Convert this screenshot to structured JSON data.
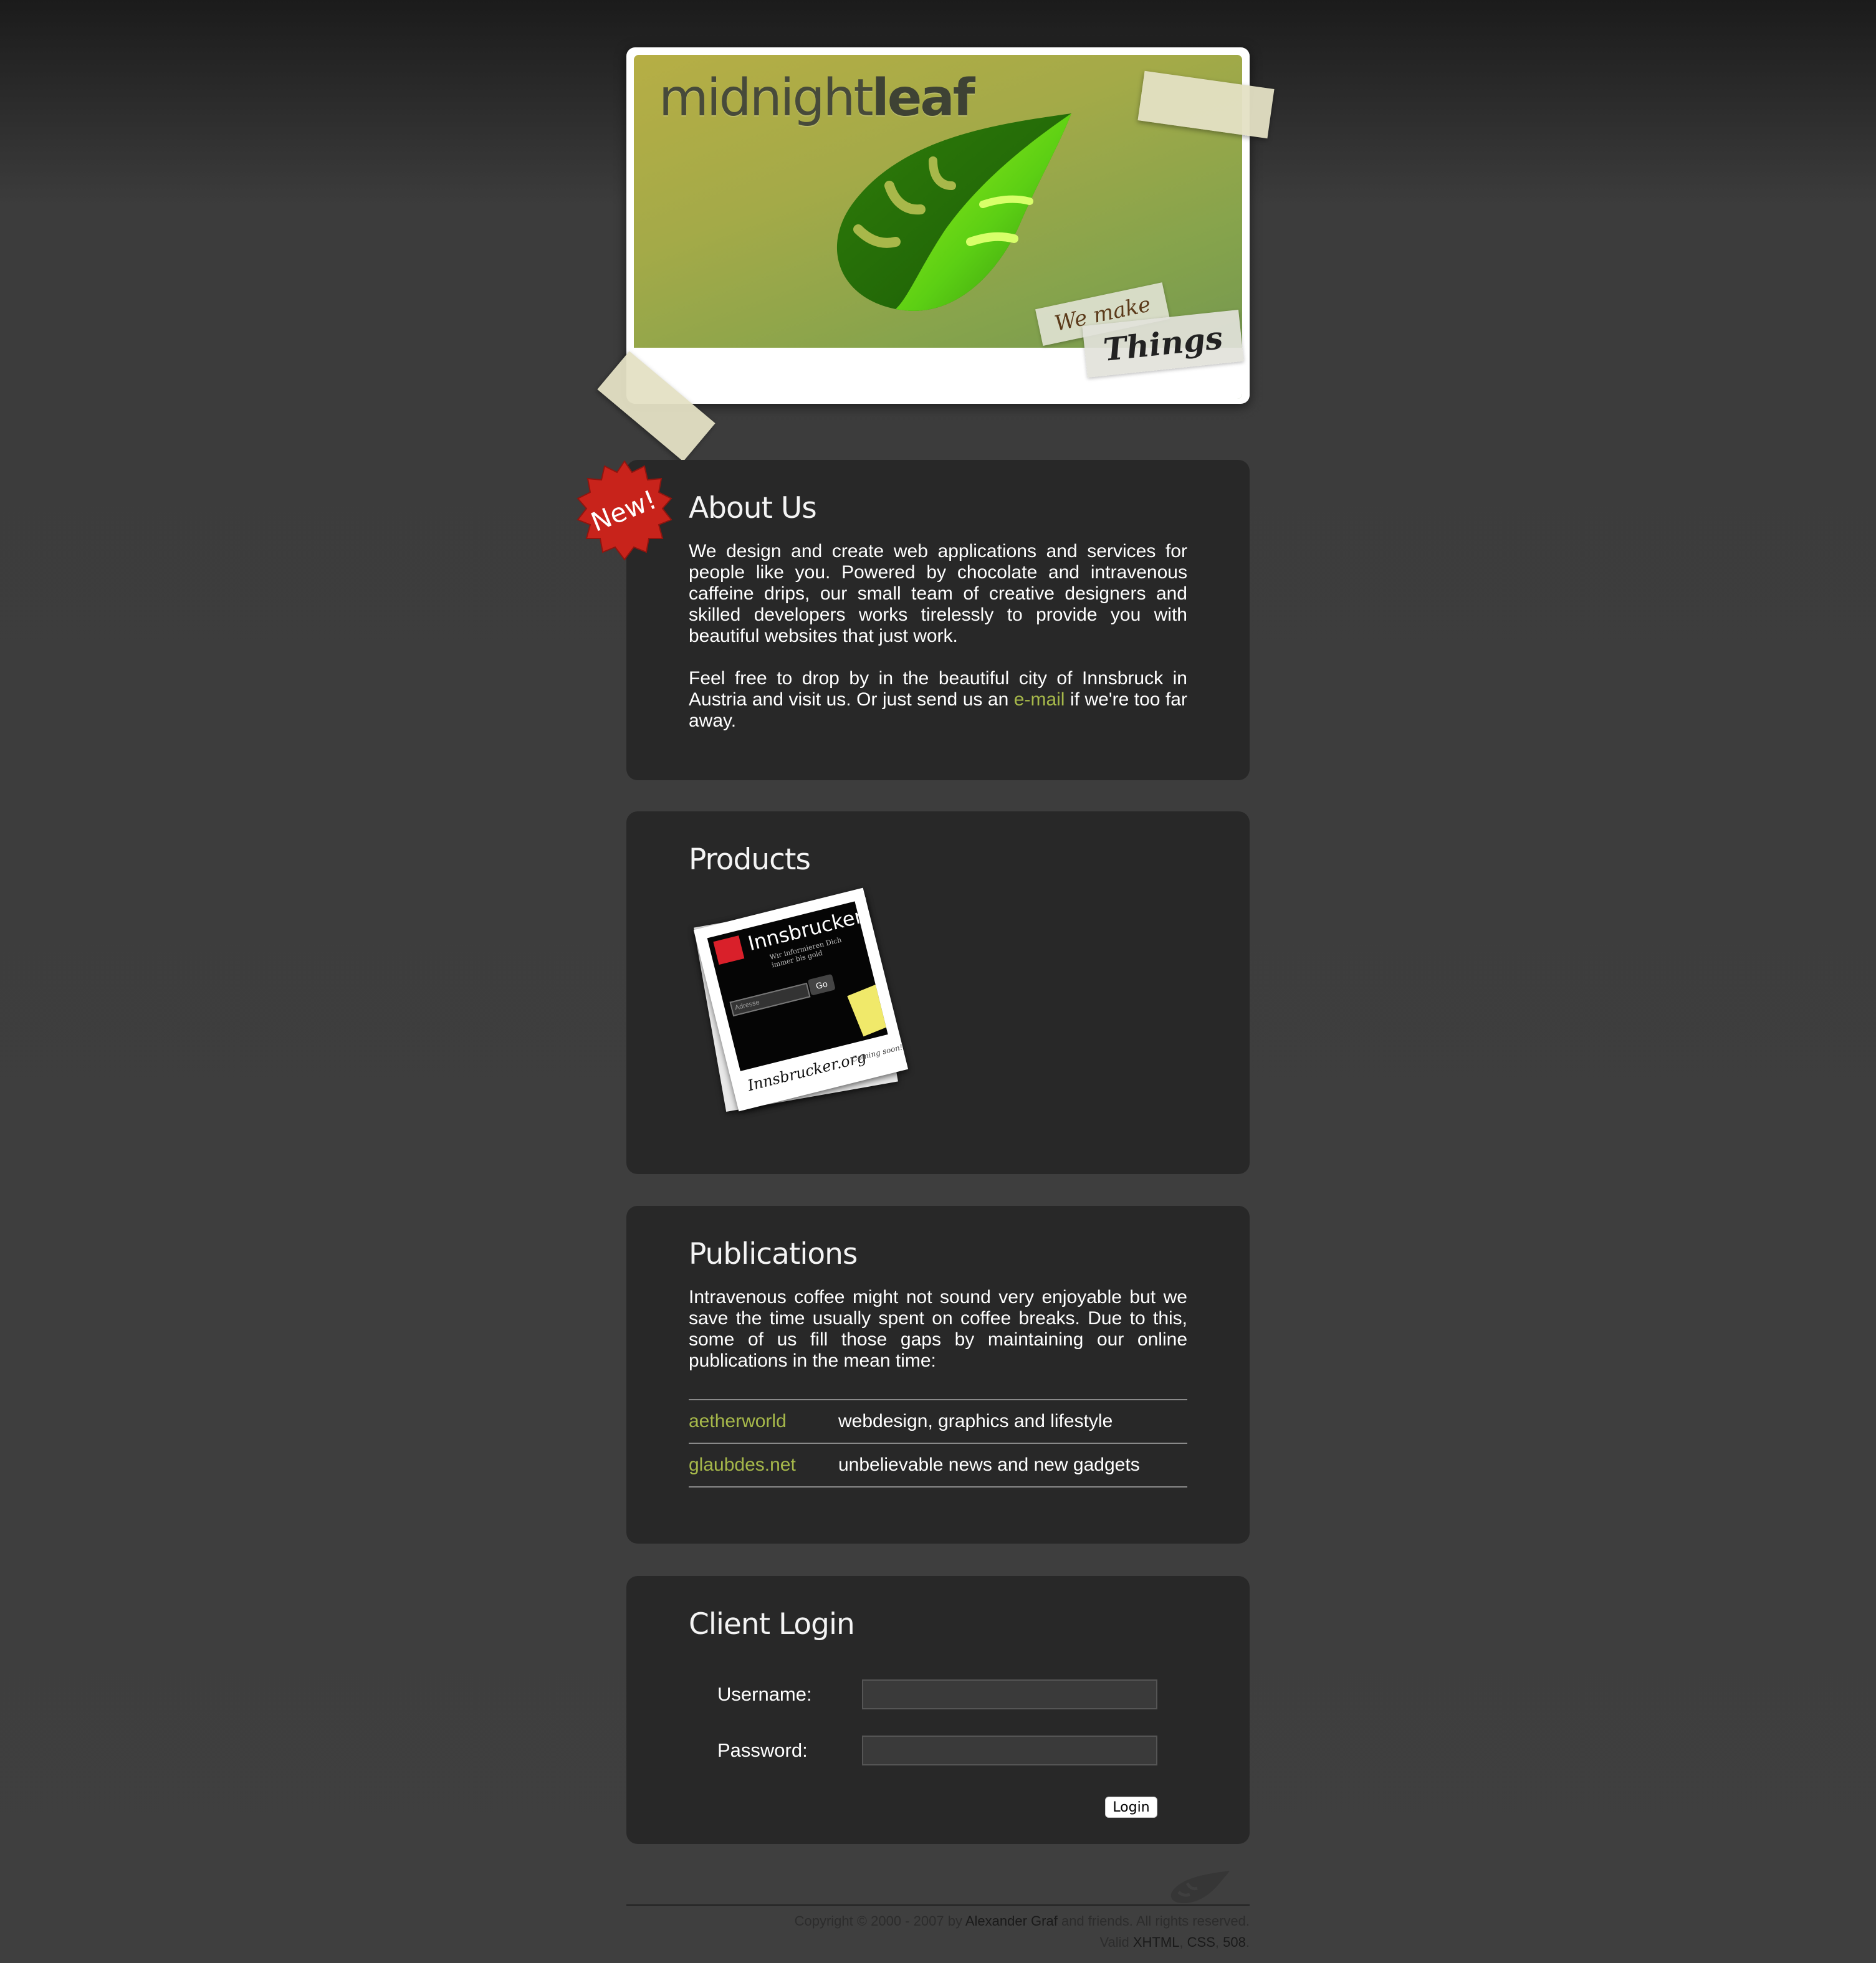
{
  "header": {
    "brand_thin": "midnight",
    "brand_bold": "leaf",
    "tag_line_1": "We make",
    "tag_line_2": "Things"
  },
  "about": {
    "badge": "New!",
    "title": "About Us",
    "paragraph_1": "We design and create web applications and services for people like you. Powered by chocolate and intravenous caffeine drips, our small team of creative designers and skilled developers works tirelessly to provide you with beautiful websites that just work.",
    "paragraph_2_before": "Feel free to drop by in the beautiful city of Innsbruck in Austria and visit us. Or just send us an ",
    "email_link": "e-mail",
    "paragraph_2_after": " if we're too far away."
  },
  "products": {
    "title": "Products",
    "polaroid": {
      "screen_title": "Innsbrucker",
      "screen_subtitle": "Wir informieren Dich immer bis gold",
      "search_placeholder": "Adresse",
      "go_label": "Go",
      "caption": "Innsbrucker.org",
      "coming_soon": "Coming soon!"
    }
  },
  "publications": {
    "title": "Publications",
    "intro": "Intravenous coffee might not sound very enjoyable but we save the time usually spent on coffee breaks. Due to this, some of us fill those gaps by maintaining our online publications in the mean time:",
    "items": [
      {
        "name": "aetherworld",
        "description": "webdesign, graphics and lifestyle"
      },
      {
        "name": "glaubdes.net",
        "description": "unbelievable news and new gadgets"
      }
    ]
  },
  "login": {
    "title": "Client Login",
    "username_label": "Username:",
    "username_value": "",
    "password_label": "Password:",
    "password_value": "",
    "button_label": "Login"
  },
  "footer": {
    "copyright_before": "Copyright © 2000 - 2007 by ",
    "author": "Alexander Graf",
    "copyright_after": " and friends. All rights reserved.",
    "valid_prefix": "Valid ",
    "valid_xhtml": "XHTML",
    "valid_sep1": ", ",
    "valid_css": "CSS",
    "valid_sep2": ", ",
    "valid_508": "508",
    "valid_end": "."
  },
  "colors": {
    "accent_green": "#a6b84a",
    "panel_bg": "#282828",
    "page_bg": "#3f3f3f",
    "badge_red": "#c8231b"
  },
  "icons": {
    "header_leaf": "leaf-icon",
    "footer_leaf": "leaf-icon",
    "new_badge": "starburst-badge"
  }
}
